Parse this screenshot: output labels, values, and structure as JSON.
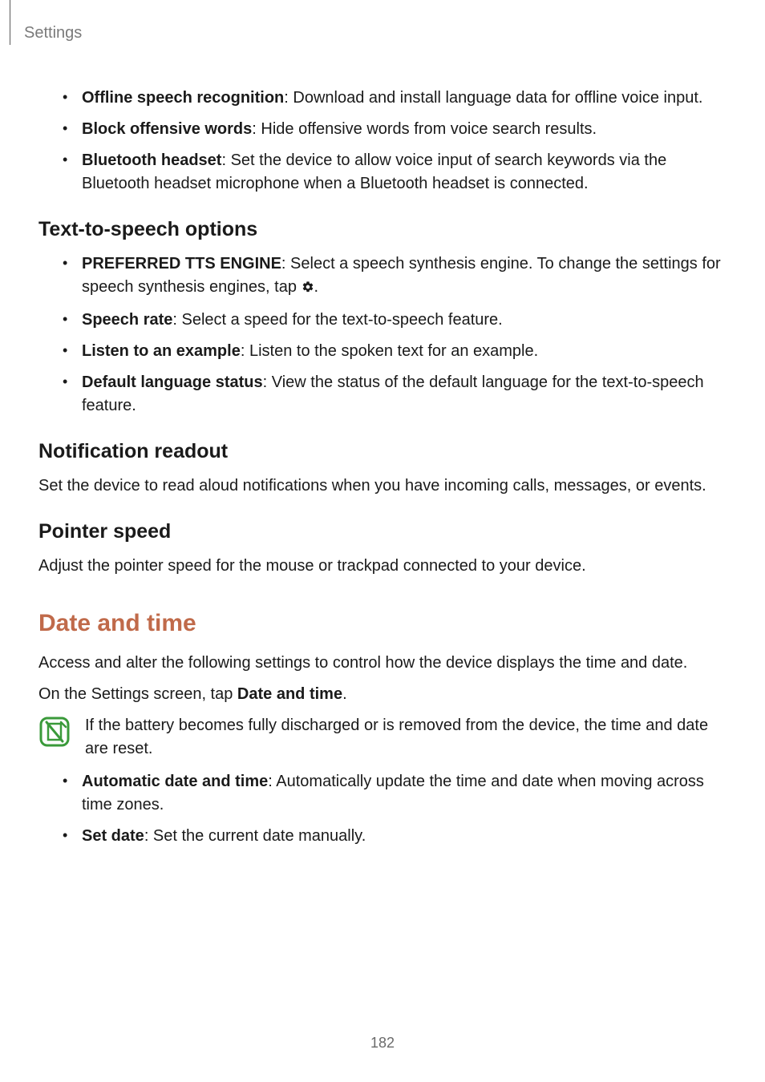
{
  "header": {
    "title": "Settings"
  },
  "list1": [
    {
      "bold": "Offline speech recognition",
      "text": ": Download and install language data for offline voice input."
    },
    {
      "bold": "Block offensive words",
      "text": ": Hide offensive words from voice search results."
    },
    {
      "bold": "Bluetooth headset",
      "text": ": Set the device to allow voice input of search keywords via the Bluetooth headset microphone when a Bluetooth headset is connected."
    }
  ],
  "tts": {
    "heading": "Text-to-speech options",
    "items": [
      {
        "bold": "PREFERRED TTS ENGINE",
        "text_before": ": Select a speech synthesis engine. To change the settings for speech synthesis engines, tap ",
        "text_after": "."
      },
      {
        "bold": "Speech rate",
        "text": ": Select a speed for the text-to-speech feature."
      },
      {
        "bold": "Listen to an example",
        "text": ": Listen to the spoken text for an example."
      },
      {
        "bold": "Default language status",
        "text": ": View the status of the default language for the text-to-speech feature."
      }
    ]
  },
  "notif": {
    "heading": "Notification readout",
    "para": "Set the device to read aloud notifications when you have incoming calls, messages, or events."
  },
  "pointer": {
    "heading": "Pointer speed",
    "para": "Adjust the pointer speed for the mouse or trackpad connected to your device."
  },
  "date": {
    "heading": "Date and time",
    "para1": "Access and alter the following settings to control how the device displays the time and date.",
    "para2_a": "On the Settings screen, tap ",
    "para2_b": "Date and time",
    "para2_c": ".",
    "note": "If the battery becomes fully discharged or is removed from the device, the time and date are reset.",
    "items": [
      {
        "bold": "Automatic date and time",
        "text": ": Automatically update the time and date when moving across time zones."
      },
      {
        "bold": "Set date",
        "text": ": Set the current date manually."
      }
    ]
  },
  "page_number": "182"
}
